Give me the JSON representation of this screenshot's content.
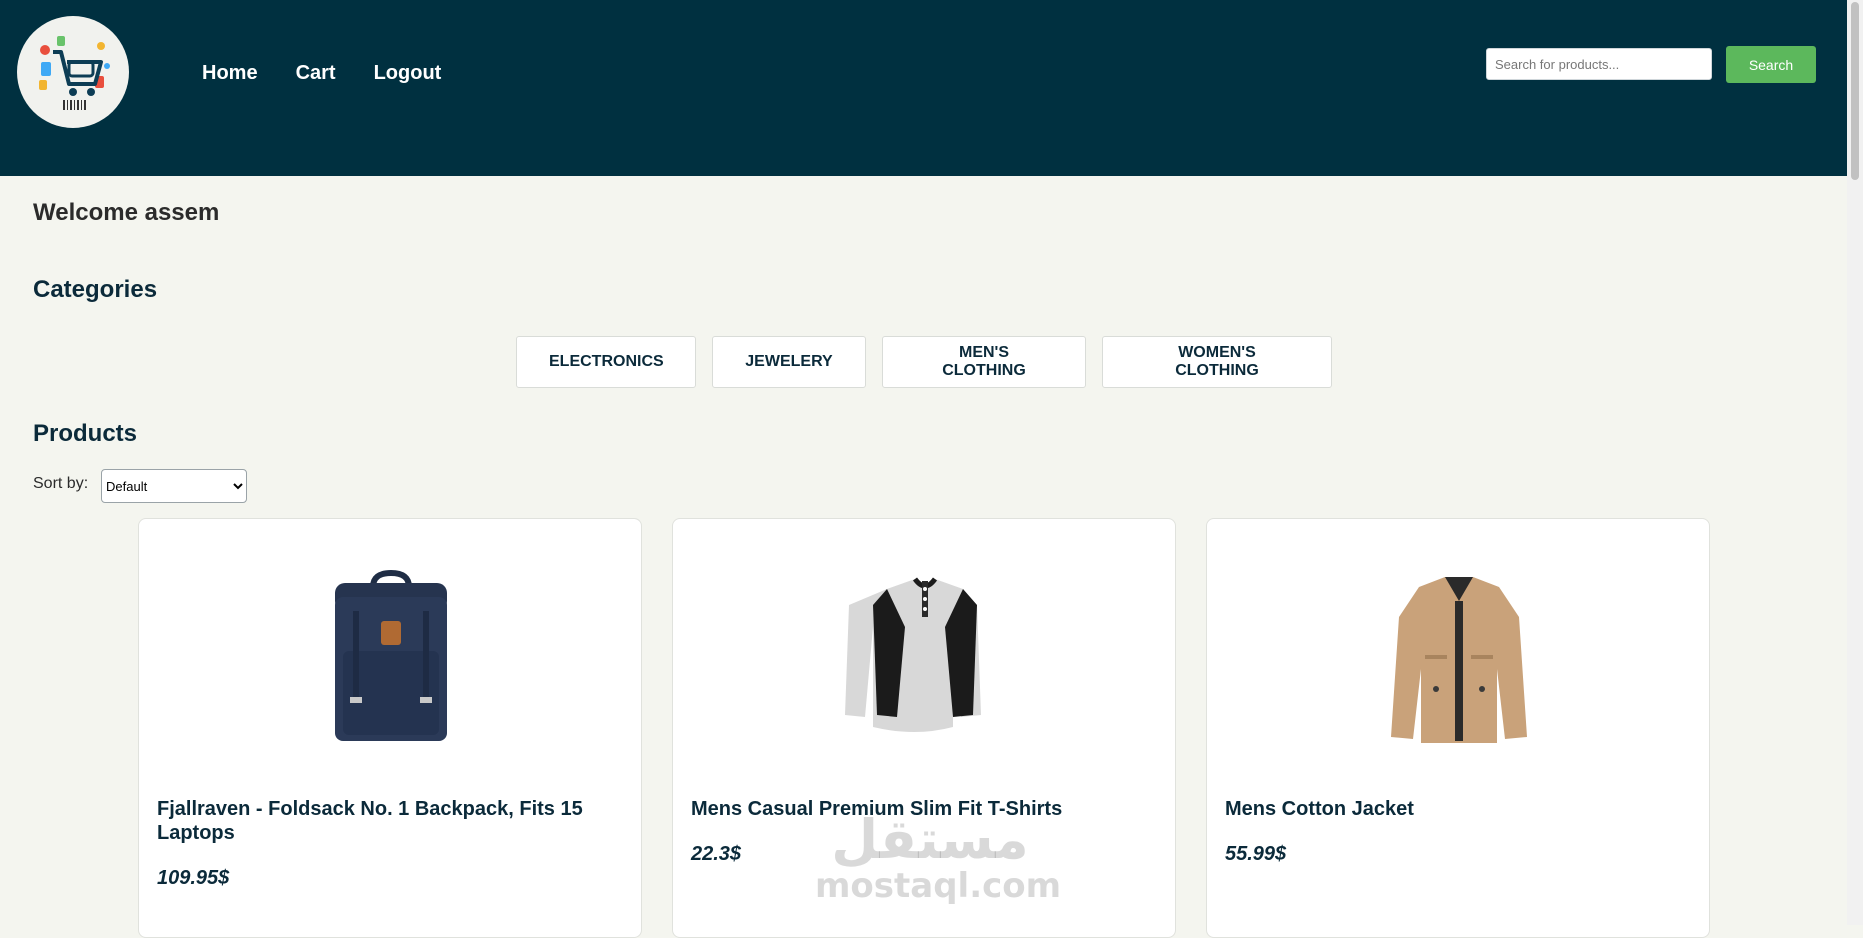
{
  "header": {
    "logo_icon": "shopping-cart-logo-icon",
    "nav": [
      {
        "label": "Home"
      },
      {
        "label": "Cart"
      },
      {
        "label": "Logout"
      }
    ],
    "search": {
      "placeholder": "Search for products...",
      "value": "",
      "button_label": "Search"
    },
    "colors": {
      "background": "#003040",
      "search_button": "#5cb85c"
    }
  },
  "main": {
    "welcome": "Welcome assem",
    "categories_title": "Categories",
    "categories": [
      "ELECTRONICS",
      "JEWELERY",
      "MEN'S CLOTHING",
      "WOMEN'S CLOTHING"
    ],
    "products_title": "Products",
    "sort_label": "Sort by:",
    "sort_selected": "Default",
    "products": [
      {
        "name": "Fjallraven - Foldsack No. 1 Backpack, Fits 15 Laptops",
        "price": "109.95$",
        "image_icon": "backpack-image"
      },
      {
        "name": "Mens Casual Premium Slim Fit T-Shirts",
        "price": "22.3$",
        "image_icon": "tshirt-image"
      },
      {
        "name": "Mens Cotton Jacket",
        "price": "55.99$",
        "image_icon": "jacket-image"
      }
    ]
  },
  "watermark": {
    "arabic": "مستقل",
    "latin": "mostaql.com"
  }
}
